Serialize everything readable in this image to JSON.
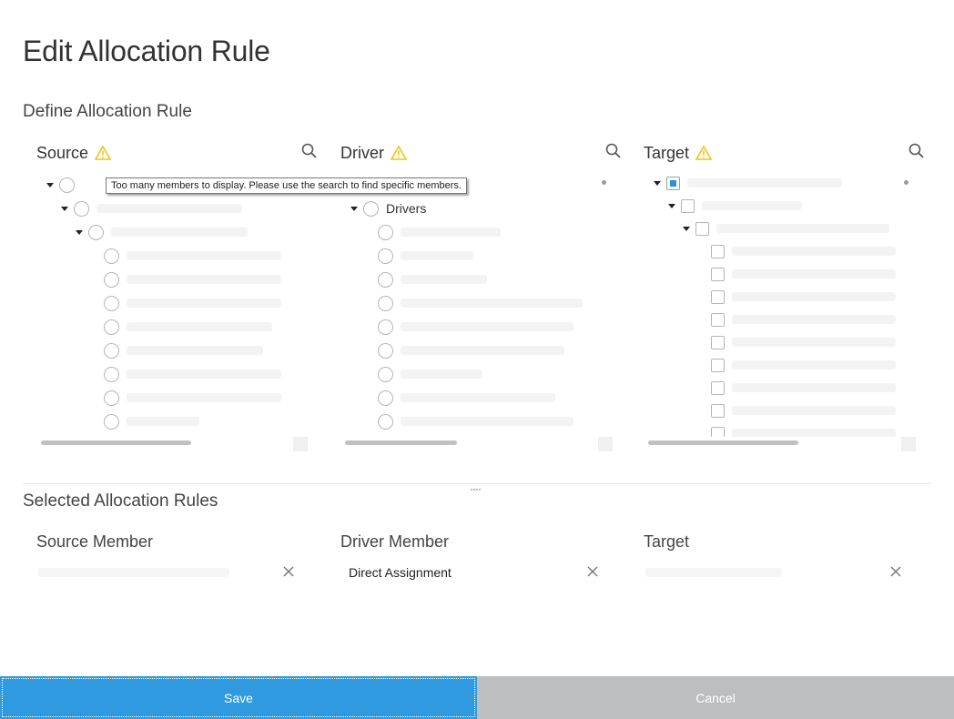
{
  "dialog": {
    "title": "Edit Allocation Rule",
    "define_section": "Define Allocation Rule",
    "selected_section": "Selected Allocation Rules"
  },
  "panels": {
    "source": {
      "title": "Source",
      "warning_icon": "warning-icon",
      "search_icon": "search-icon"
    },
    "driver": {
      "title": "Driver",
      "warning_icon": "warning-icon",
      "search_icon": "search-icon",
      "child_label": "Drivers"
    },
    "target": {
      "title": "Target",
      "warning_icon": "warning-icon",
      "search_icon": "search-icon"
    }
  },
  "tooltip": "Too many members to display. Please use the search to find specific members.",
  "selected": {
    "source_header": "Source Member",
    "driver_header": "Driver Member",
    "driver_value": "Direct Assignment",
    "target_header": "Target"
  },
  "footer": {
    "save_label": "Save",
    "cancel_label": "Cancel"
  },
  "colors": {
    "save_bg": "#2f9ae0",
    "cancel_bg": "#bdbebf",
    "warning": "#f0c419"
  }
}
